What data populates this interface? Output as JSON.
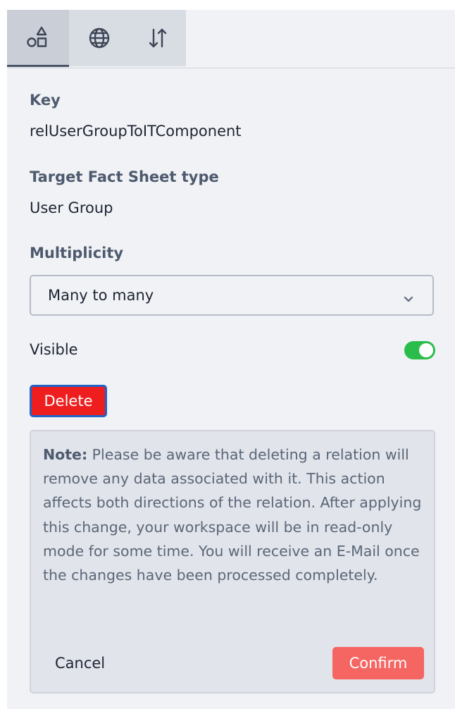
{
  "tabs": [
    {
      "icon": "shapes-icon",
      "active": true
    },
    {
      "icon": "globe-icon",
      "active": false
    },
    {
      "icon": "sort-arrows-icon",
      "active": false
    }
  ],
  "fields": {
    "key_label": "Key",
    "key_value": "relUserGroupToITComponent",
    "target_label": "Target Fact Sheet type",
    "target_value": "User Group",
    "multiplicity_label": "Multiplicity",
    "multiplicity_value": "Many to many",
    "visible_label": "Visible",
    "visible_on": true
  },
  "actions": {
    "delete_label": "Delete"
  },
  "note": {
    "prefix": "Note:",
    "text": " Please be aware that deleting a relation will remove any data associated with it. This action affects both directions of the relation. After applying this change, your workspace will be in read-only mode for some time. You will receive an E-Mail once the changes have been processed completely.",
    "cancel_label": "Cancel",
    "confirm_label": "Confirm"
  },
  "colors": {
    "delete": "#ee1e1e",
    "confirm": "#f56562",
    "toggle_on": "#2bbd4b"
  }
}
